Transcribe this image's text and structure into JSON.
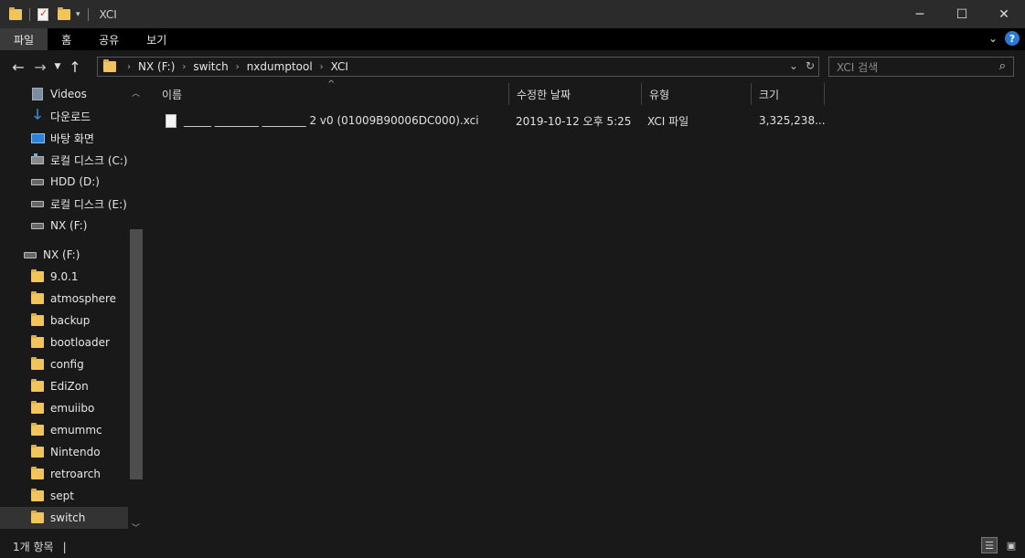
{
  "window": {
    "title": "XCI"
  },
  "ribbon": {
    "tabs": [
      {
        "label": "파일"
      },
      {
        "label": "홈"
      },
      {
        "label": "공유"
      },
      {
        "label": "보기"
      }
    ]
  },
  "address": {
    "crumbs": [
      "NX (F:)",
      "switch",
      "nxdumptool",
      "XCI"
    ]
  },
  "search": {
    "placeholder": "XCI 검색"
  },
  "sidebar": {
    "items": [
      {
        "label": "Videos",
        "icon": "video-icon"
      },
      {
        "label": "다운로드",
        "icon": "download-icon"
      },
      {
        "label": "바탕 화면",
        "icon": "desktop-icon"
      },
      {
        "label": "로컬 디스크 (C:)",
        "icon": "system-drive-icon"
      },
      {
        "label": "HDD (D:)",
        "icon": "drive-icon"
      },
      {
        "label": "로컬 디스크 (E:)",
        "icon": "drive-icon"
      },
      {
        "label": "NX (F:)",
        "icon": "drive-icon"
      },
      {
        "label": "NX (F:)",
        "icon": "drive-icon"
      },
      {
        "label": "9.0.1",
        "icon": "folder-icon"
      },
      {
        "label": "atmosphere",
        "icon": "folder-icon"
      },
      {
        "label": "backup",
        "icon": "folder-icon"
      },
      {
        "label": "bootloader",
        "icon": "folder-icon"
      },
      {
        "label": "config",
        "icon": "folder-icon"
      },
      {
        "label": "EdiZon",
        "icon": "folder-icon"
      },
      {
        "label": "emuiibo",
        "icon": "folder-icon"
      },
      {
        "label": "emummc",
        "icon": "folder-icon"
      },
      {
        "label": "Nintendo",
        "icon": "folder-icon"
      },
      {
        "label": "retroarch",
        "icon": "folder-icon"
      },
      {
        "label": "sept",
        "icon": "folder-icon"
      },
      {
        "label": "switch",
        "icon": "folder-icon"
      }
    ]
  },
  "columns": [
    {
      "label": "이름"
    },
    {
      "label": "수정한 날짜"
    },
    {
      "label": "유형"
    },
    {
      "label": "크기"
    }
  ],
  "files": [
    {
      "name": "_____ ________ ________ 2 v0 (01009B90006DC000).xci",
      "modified": "2019-10-12 오후 5:25",
      "type": "XCI 파일",
      "size": "3,325,238..."
    }
  ],
  "status": {
    "item_count": "1개 항목"
  }
}
